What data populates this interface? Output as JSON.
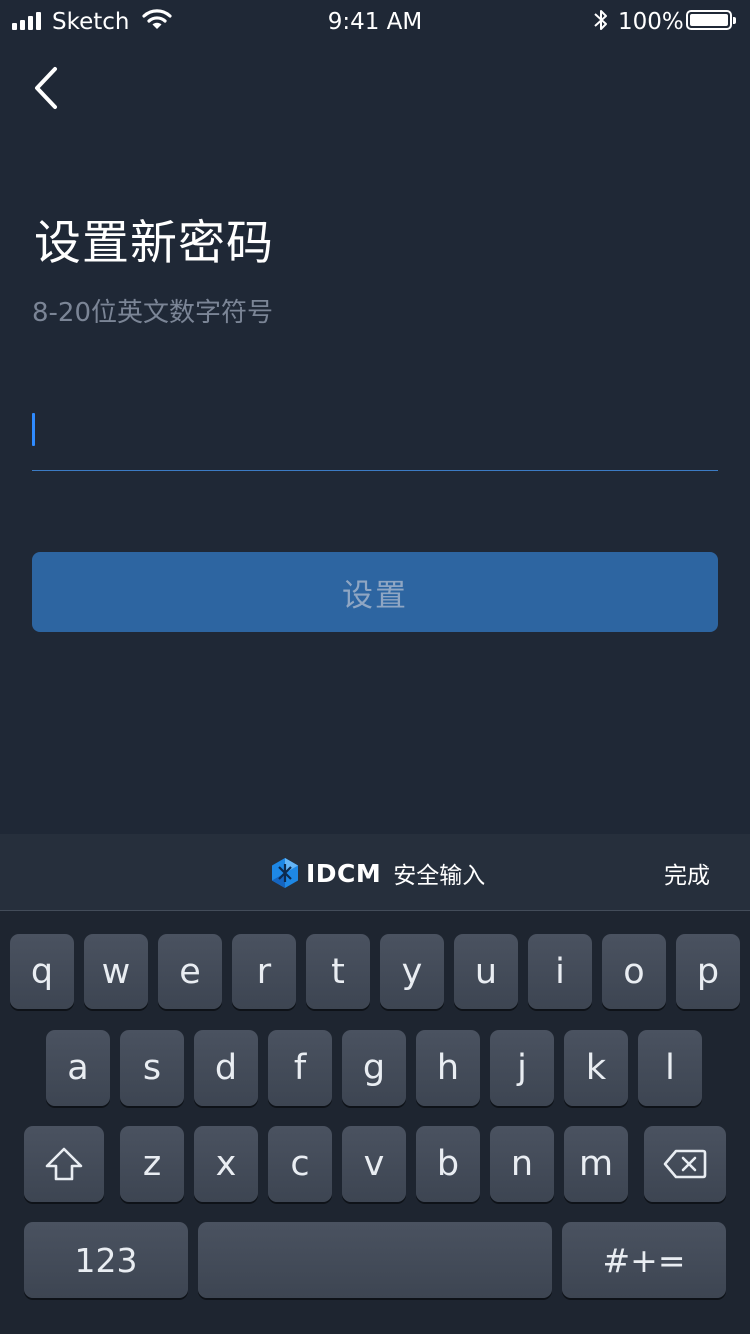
{
  "status_bar": {
    "carrier": "Sketch",
    "time": "9:41 AM",
    "battery": "100%"
  },
  "page": {
    "title": "设置新密码",
    "subtitle": "8-20位英文数字符号"
  },
  "password_field": {
    "value": "",
    "placeholder": ""
  },
  "set_button_label": "设置",
  "keyboard_bar": {
    "brand": "IDCM",
    "label": "安全输入",
    "done": "完成"
  },
  "keyboard": {
    "row1": [
      "q",
      "w",
      "e",
      "r",
      "t",
      "y",
      "u",
      "i",
      "o",
      "p"
    ],
    "row2": [
      "a",
      "s",
      "d",
      "f",
      "g",
      "h",
      "j",
      "k",
      "l"
    ],
    "row3": [
      "z",
      "x",
      "c",
      "v",
      "b",
      "n",
      "m"
    ],
    "numbers_key": "123",
    "symbols_key": "#+=",
    "space_key": ""
  },
  "colors": {
    "background": "#1f2836",
    "accent": "#2d65a1",
    "caret": "#2f8bff",
    "brand_logo": "#1e88e5"
  }
}
